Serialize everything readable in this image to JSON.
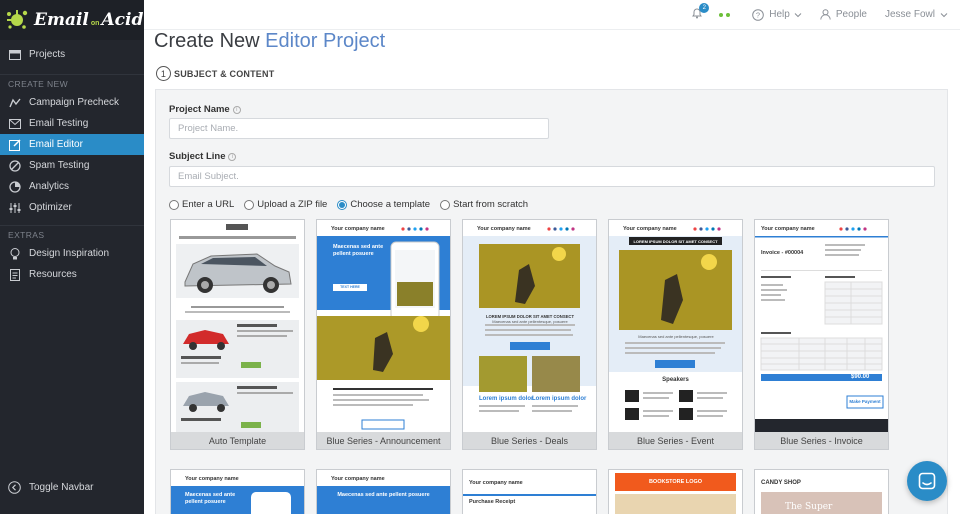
{
  "logo": {
    "text_a": "Email",
    "text_on": "on",
    "text_b": "Acid"
  },
  "sidebar": {
    "projects": "Projects",
    "create_new_label": "CREATE NEW",
    "create_items": [
      "Campaign Precheck",
      "Email Testing",
      "Email Editor",
      "Spam Testing",
      "Analytics",
      "Optimizer"
    ],
    "extras_label": "EXTRAS",
    "extras_items": [
      "Design Inspiration",
      "Resources"
    ],
    "toggle": "Toggle Navbar"
  },
  "topbar": {
    "notification_count": "2",
    "help": "Help",
    "people": "People",
    "user": "Jesse Fowl"
  },
  "page": {
    "title_a": "Create New",
    "title_b": "Editor Project",
    "step_number": "1",
    "step_label": "SUBJECT & CONTENT"
  },
  "form": {
    "project_name_label": "Project Name",
    "project_name_placeholder": "Project Name.",
    "subject_label": "Subject Line",
    "subject_placeholder": "Email Subject.",
    "options": [
      "Enter a URL",
      "Upload a ZIP file",
      "Choose a template",
      "Start from scratch"
    ],
    "selected_option": "Choose a template"
  },
  "templates": [
    {
      "caption": "Auto Template",
      "company": ""
    },
    {
      "caption": "Blue Series - Announcement",
      "company": "Your company name",
      "headline": "Maecenas sed ante pellent posuere",
      "button": "TEXT HERE"
    },
    {
      "caption": "Blue Series - Deals",
      "company": "Your company name",
      "headline": "LOREM IPSUM DOLOR SIT AMET CONSECT",
      "sub": "Maecenas sed ante pellentesque, posuere",
      "item1": "Lorem ipsum dolor",
      "item2": "Lorem ipsum dolor"
    },
    {
      "caption": "Blue Series - Event",
      "company": "Your company name",
      "headline": "LOREM IPSUM DOLOR SIT AMET CONSECT",
      "sub": "Maecenas sed ante pellentesque, posuere",
      "speakers": "Speakers"
    },
    {
      "caption": "Blue Series - Invoice",
      "company": "Your company name",
      "invoice": "Invoice - #00004",
      "total": "$90.00",
      "pay": "Make Payment"
    }
  ],
  "templates_row2": [
    {
      "company": "Your company name",
      "headline": "Maecenas sed ante pellent posuere"
    },
    {
      "company": "Your company name",
      "headline": "Maecenas sed ante pellent posuere"
    },
    {
      "company": "Your company name",
      "label": "Purchase Receipt"
    },
    {
      "label": "BOOKSTORE LOGO"
    },
    {
      "label": "CANDY SHOP",
      "sub": "The Super"
    }
  ],
  "colors": {
    "accent": "#2a8cc7",
    "sidebar": "#23262d",
    "title_accent": "#5c87c8"
  }
}
